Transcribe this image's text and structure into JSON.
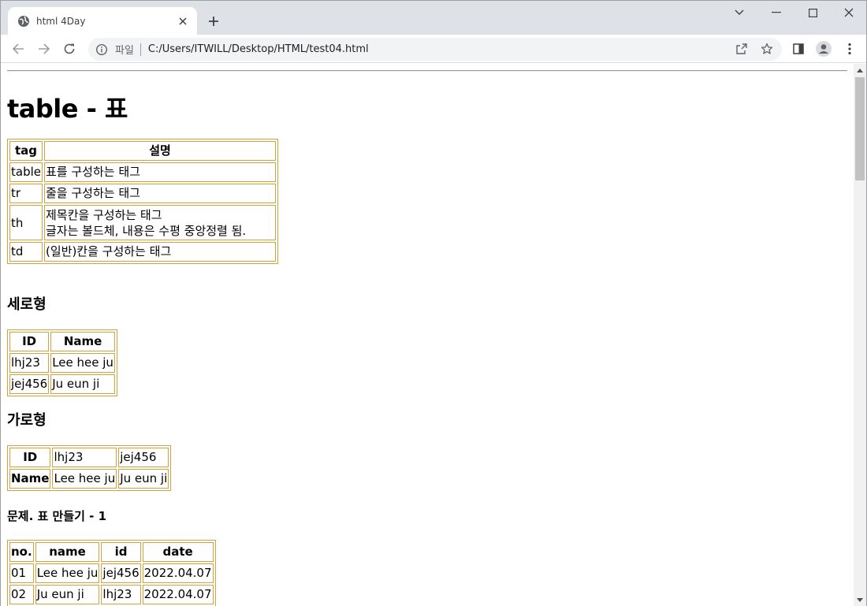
{
  "browser": {
    "tab_title": "html 4Day",
    "scheme_label": "파일",
    "url": "C:/Users/ITWILL/Desktop/HTML/test04.html"
  },
  "page": {
    "title": "table - 표",
    "table1": {
      "headers": [
        "tag",
        "설명"
      ],
      "rows": [
        [
          "table",
          "표를 구성하는 태그"
        ],
        [
          "tr",
          "줄을 구성하는 태그"
        ],
        [
          "th",
          "제목칸을 구성하는 태그",
          "글자는 볼드체, 내용은 수평 중앙정렬 됨."
        ],
        [
          "td",
          "(일반)칸을 구성하는 태그"
        ]
      ]
    },
    "section_vertical": "세로형",
    "table2": {
      "headers": [
        "ID",
        "Name"
      ],
      "rows": [
        [
          "lhj23",
          "Lee hee ju"
        ],
        [
          "jej456",
          "Ju eun ji"
        ]
      ]
    },
    "section_horizontal": "가로형",
    "table3": {
      "rows": [
        {
          "header": "ID",
          "cells": [
            "lhj23",
            "jej456"
          ]
        },
        {
          "header": "Name",
          "cells": [
            "Lee hee ju",
            "Ju eun ji"
          ]
        }
      ]
    },
    "section_exercise": "문제. 표 만들기 - 1",
    "table4": {
      "headers": [
        "no.",
        "name",
        "id",
        "date"
      ],
      "rows": [
        [
          "01",
          "Lee hee ju",
          "jej456",
          "2022.04.07"
        ],
        [
          "02",
          "Ju eun ji",
          "lhj23",
          "2022.04.07"
        ]
      ]
    }
  },
  "colors": {
    "table_border": "#d4a13a",
    "tabstrip_bg": "#dee1e6",
    "omnibox_bg": "#f1f3f4"
  },
  "icons": [
    "globe-icon",
    "close-icon",
    "plus-icon",
    "chevron-down-icon",
    "minimize-icon",
    "maximize-icon",
    "window-close-icon",
    "back-arrow-icon",
    "forward-arrow-icon",
    "reload-icon",
    "info-icon",
    "share-icon",
    "star-icon",
    "side-panel-icon",
    "profile-icon",
    "kebab-menu-icon"
  ]
}
